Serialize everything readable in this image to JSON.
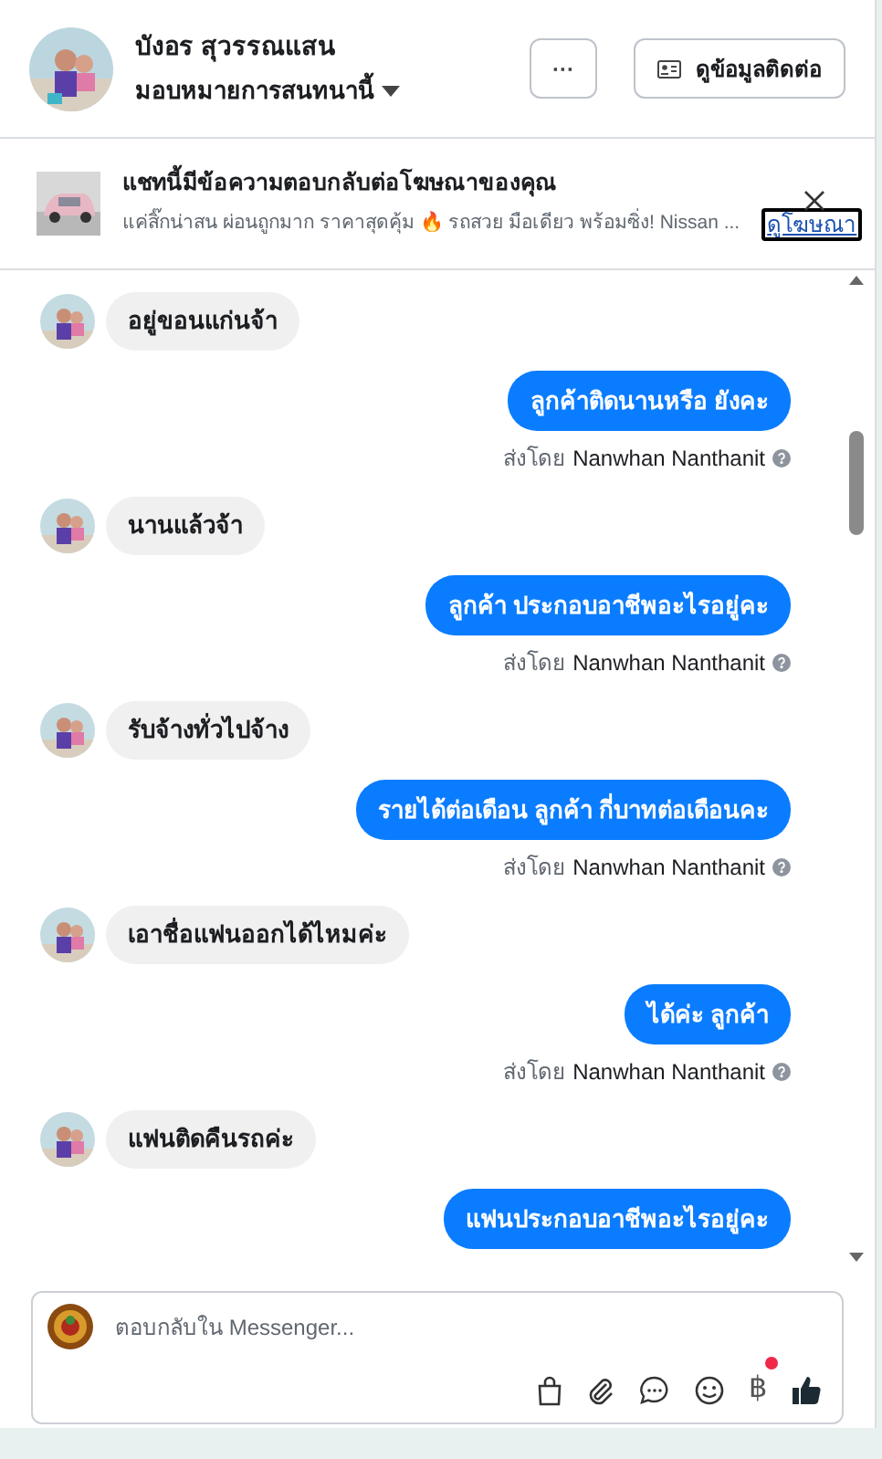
{
  "header": {
    "name": "บังอร สุวรรณแสน",
    "assign": "มอบหมายการสนทนานี้",
    "more": "···",
    "contact_button": "ดูข้อมูลติดต่อ"
  },
  "ad": {
    "title": "แชทนี้มีข้อความตอบกลับต่อโฆษณาของคุณ",
    "text": "แค่สิ๊กน่าสน ผ่อนถูกมาก ราคาสุดคุ้ม 🔥 รถสวย มือเดียว พร้อมซิ่ง! Nissan ...",
    "link": "ดูโฆษณา"
  },
  "messages": [
    {
      "kind": "incoming",
      "text": "อยู่ขอนแก่นจ้า"
    },
    {
      "kind": "outgoing",
      "text": "ลูกค้าติดนานหรือ ยังคะ",
      "sent_by": "ส่งโดย",
      "sender": "Nanwhan Nanthanit"
    },
    {
      "kind": "incoming",
      "text": "นานแล้วจ้า"
    },
    {
      "kind": "outgoing",
      "text": "ลูกค้า ประกอบอาชีพอะไรอยู่คะ",
      "sent_by": "ส่งโดย",
      "sender": "Nanwhan Nanthanit"
    },
    {
      "kind": "incoming",
      "text": "รับจ้างทั่วไปจ้าง"
    },
    {
      "kind": "outgoing",
      "text": "รายได้ต่อเดือน ลูกค้า กี่บาทต่อเดือนคะ",
      "sent_by": "ส่งโดย",
      "sender": "Nanwhan Nanthanit"
    },
    {
      "kind": "incoming",
      "text": "เอาชื่อแฟนออกได้ไหมค่ะ"
    },
    {
      "kind": "outgoing",
      "text": "ได้ค่ะ  ลูกค้า",
      "sent_by": "ส่งโดย",
      "sender": "Nanwhan Nanthanit"
    },
    {
      "kind": "incoming",
      "text": "แฟนติดคืนรถค่ะ"
    },
    {
      "kind": "outgoing",
      "text": "แฟนประกอบอาชีพอะไรอยู่คะ"
    }
  ],
  "composer": {
    "placeholder": "ตอบกลับใน Messenger...",
    "currency": "฿",
    "currency_badge": true
  }
}
